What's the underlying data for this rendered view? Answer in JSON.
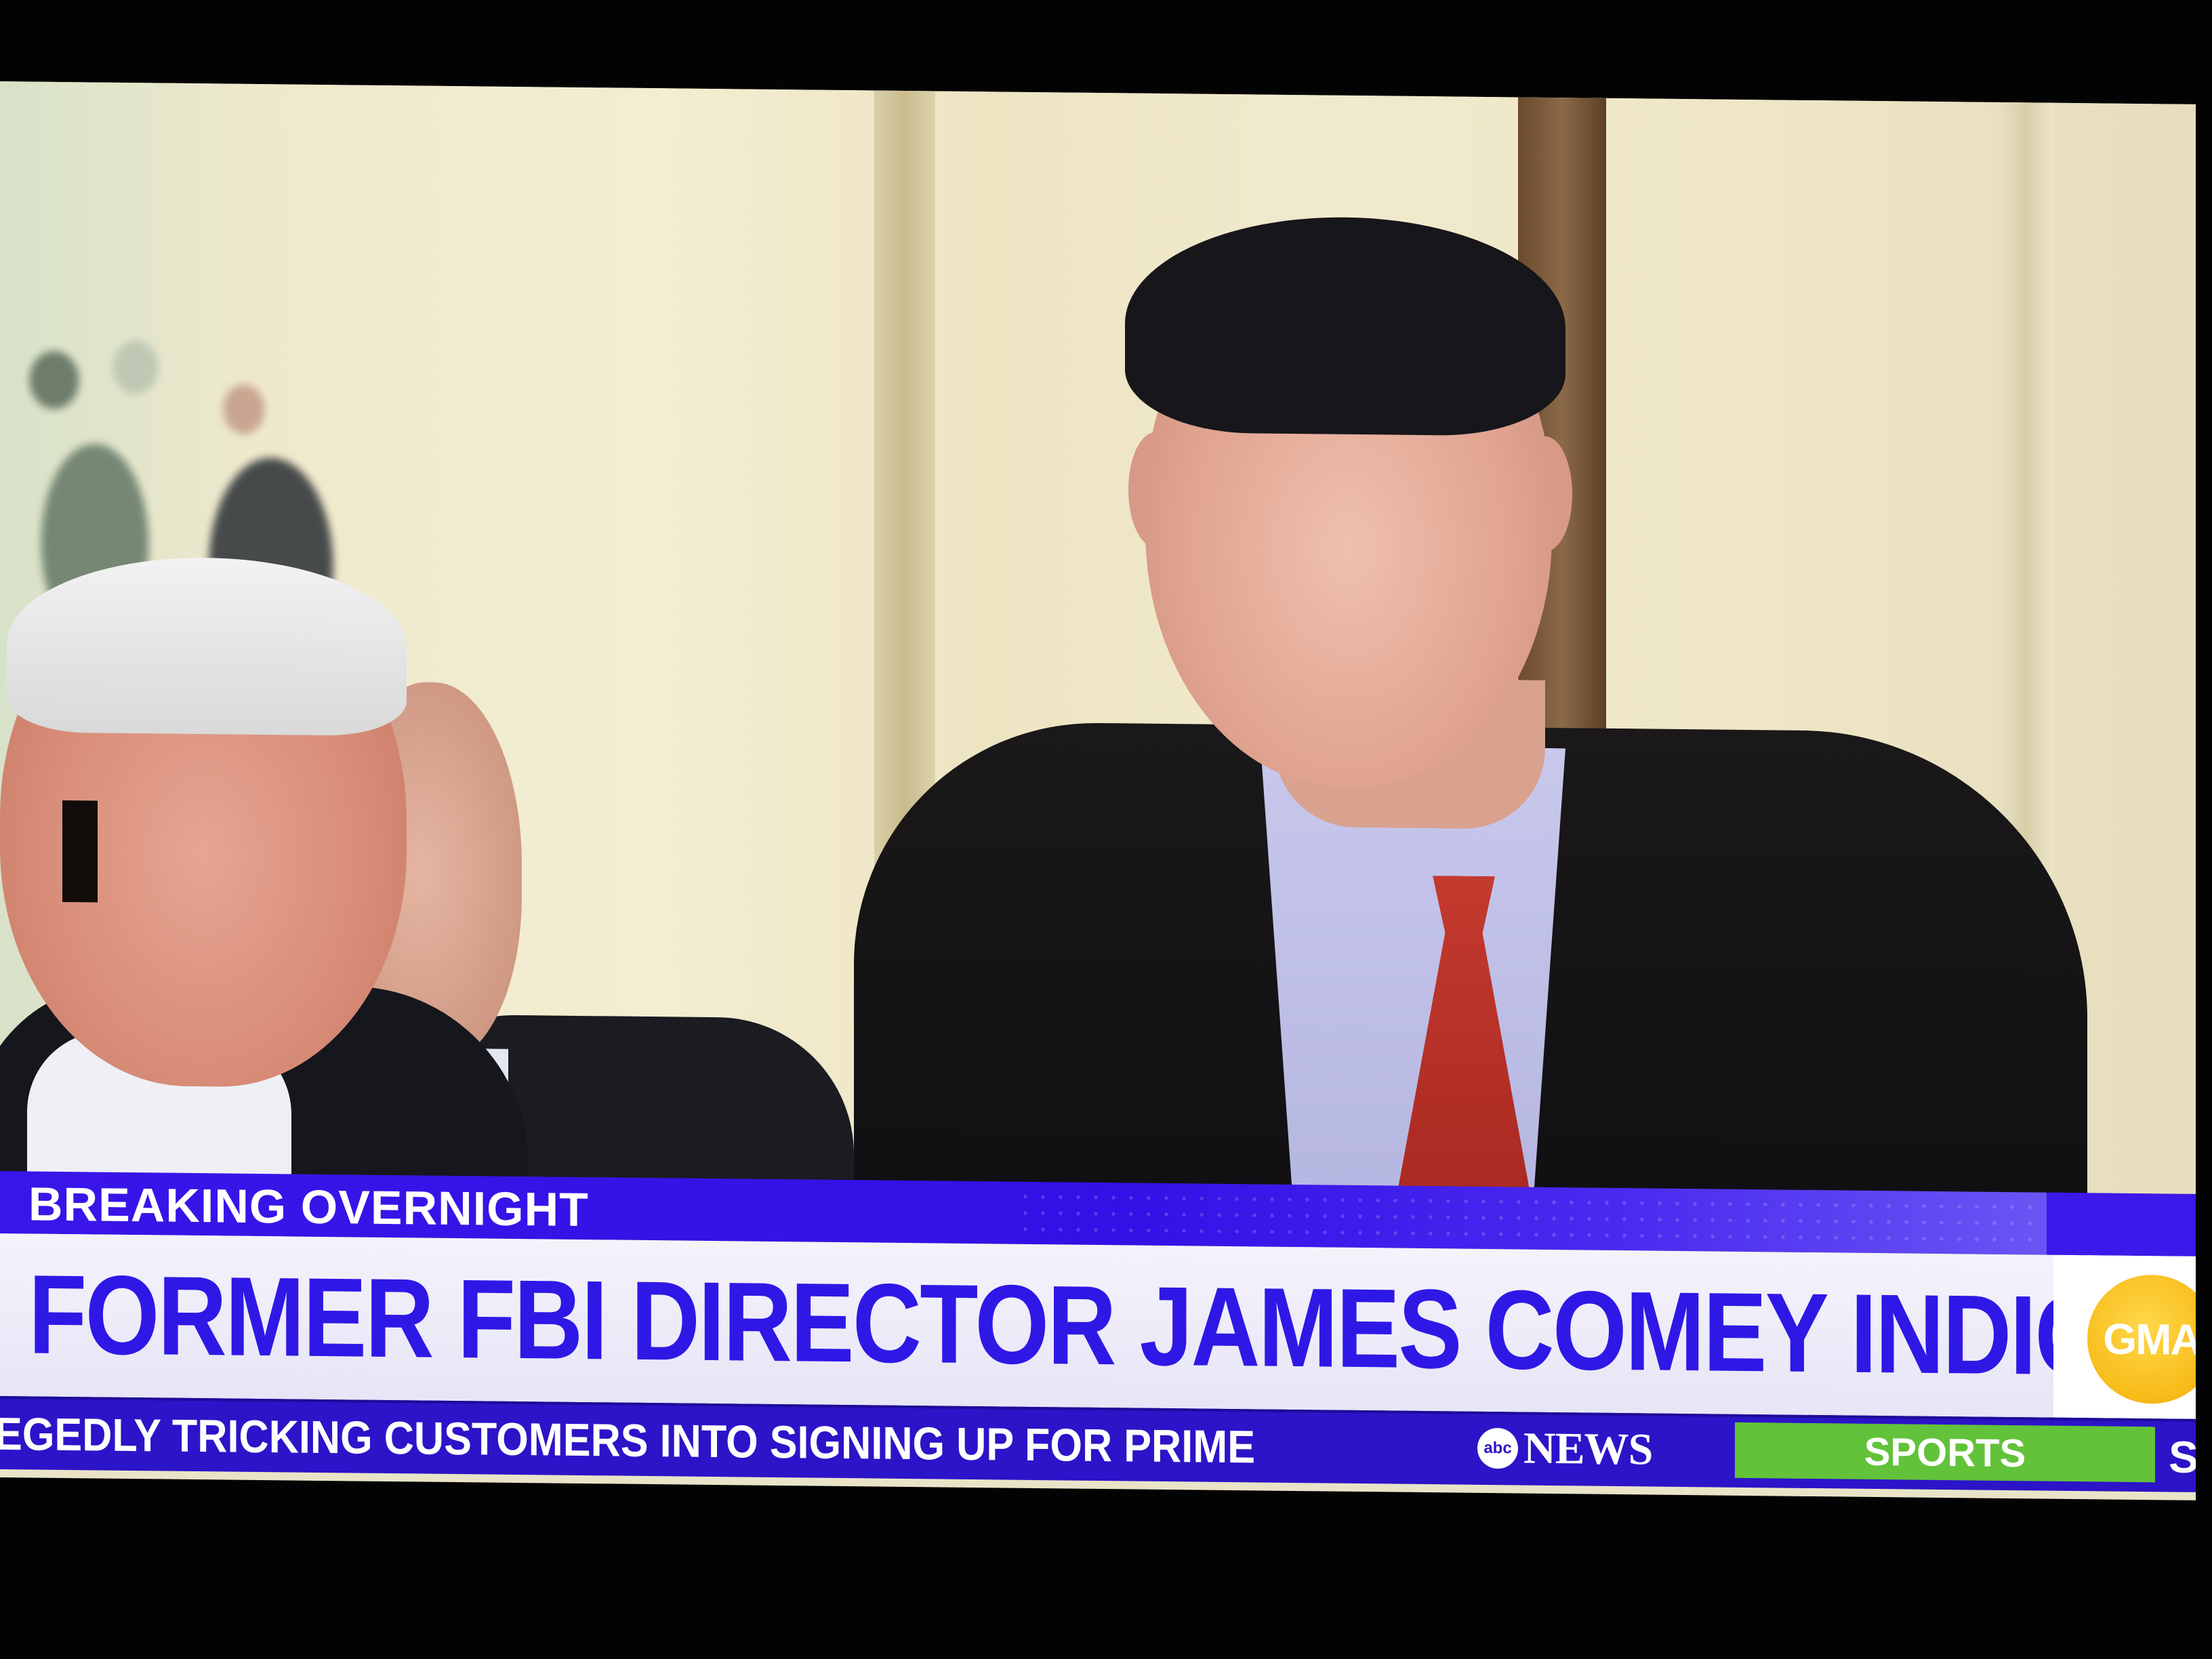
{
  "lower_third": {
    "kicker": "BREAKING OVERNIGHT",
    "headline": "FORMER FBI DIRECTOR JAMES COMEY INDICTED",
    "logo": "GMA"
  },
  "ticker": {
    "text": "EGEDLY TRICKING CUSTOMERS INTO SIGNING UP FOR PRIME",
    "brand_small": "abc",
    "brand_news": "NEWS",
    "section": "SPORTS",
    "tail": "S"
  },
  "colors": {
    "brand_blue": "#3a15e8",
    "headline_blue": "#2f18e6",
    "logo_yellow": "#f7bb18",
    "sports_green": "#62c23a"
  },
  "icons": [
    "gma-logo-icon",
    "abc-news-logo-icon"
  ]
}
